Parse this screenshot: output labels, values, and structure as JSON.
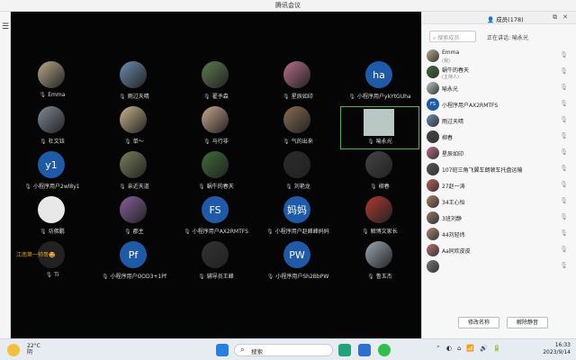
{
  "window": {
    "title": "腾讯会议"
  },
  "sidebar_left": {
    "menu_icon": "menu-icon"
  },
  "grid_tiles": [
    {
      "name": "Emma",
      "type": "photo",
      "color": "#b9a98a"
    },
    {
      "name": "雨过天晴",
      "type": "photo",
      "color": "#6a8fb0"
    },
    {
      "name": "翟予森",
      "type": "photo",
      "color": "#5d7d4f"
    },
    {
      "name": "星辰如印",
      "type": "photo",
      "color": "#b86e8a"
    },
    {
      "name": "小程序用户ykYtGUha",
      "type": "text",
      "initials": "ha",
      "color": "#1e5aa8"
    },
    {
      "name": "杜文钰",
      "type": "photo",
      "color": "#7f8b94"
    },
    {
      "name": "单～",
      "type": "photo",
      "color": "#c9b38a"
    },
    {
      "name": "马行非",
      "type": "photo",
      "color": "#c8a68e"
    },
    {
      "name": "气的出来",
      "type": "photo",
      "color": "#8a6c52"
    },
    {
      "name": "喻永光",
      "type": "video",
      "color": "#b9c8c5"
    },
    {
      "name": "小程序用户2wl8y1",
      "type": "text",
      "initials": "y1",
      "color": "#1e5aa8"
    },
    {
      "name": "亲近天道",
      "type": "photo",
      "color": "#7a7f5a"
    },
    {
      "name": "蜗牛的春天",
      "type": "photo",
      "color": "#3b6f36"
    },
    {
      "name": "刘艳龙",
      "type": "photo",
      "color": "#2b2b2b"
    },
    {
      "name": "柳春",
      "type": "photo",
      "color": "#444"
    },
    {
      "name": "坊佛鹏",
      "type": "blank",
      "color": "#e8e8e8"
    },
    {
      "name": "郡主",
      "type": "photo",
      "color": "#8a5fa0"
    },
    {
      "name": "小程序用户AX2RMTFS",
      "type": "text",
      "initials": "FS",
      "color": "#1e5aa8"
    },
    {
      "name": "小程序用户赵峰峰妈妈",
      "type": "text",
      "initials": "妈妈",
      "color": "#1e5aa8"
    },
    {
      "name": "解博文家长",
      "type": "photo",
      "color": "#b03a2e"
    },
    {
      "name": "Ti",
      "type": "photo",
      "color": "#222"
    },
    {
      "name": "小程序用户OOD3+1Pf",
      "type": "text",
      "initials": "Pf",
      "color": "#1e5aa8"
    },
    {
      "name": "辅导员王峰",
      "type": "photo",
      "color": "#333"
    },
    {
      "name": "小程序用户Sh2BbPW",
      "type": "text",
      "initials": "PW",
      "color": "#1e5aa8"
    },
    {
      "name": "鲁玉杰",
      "type": "photo",
      "color": "#9aa8b5"
    }
  ],
  "grid_extra_text": "江南第一帅哥🤩",
  "panel": {
    "title": "成员(178)",
    "search_placeholder": "搜索成员",
    "speaking_label": "正在讲话:",
    "speaking_name": "喻永光",
    "rename_button": "修改名称",
    "unmute_button": "解除静音"
  },
  "members": [
    {
      "name": "Emma",
      "sub": "(我)",
      "type": "photo",
      "color": "#b9a98a"
    },
    {
      "name": "蜗牛的春天",
      "sub": "(主持人)",
      "type": "photo",
      "color": "#3b6f36"
    },
    {
      "name": "喻永光",
      "sub": "",
      "type": "photo",
      "color": "#b9c8c5"
    },
    {
      "name": "小程序用户AX2RMTFS",
      "sub": "",
      "type": "text",
      "initials": "FS",
      "color": "#1e5aa8"
    },
    {
      "name": "雨过天晴",
      "sub": "",
      "type": "photo",
      "color": "#6a8fb0"
    },
    {
      "name": "柳春",
      "sub": "",
      "type": "photo",
      "color": "#444"
    },
    {
      "name": "星辰如印",
      "sub": "",
      "type": "photo",
      "color": "#b86e8a"
    },
    {
      "name": "107班三角飞翼车朗顿车托盘运输",
      "sub": "",
      "type": "photo",
      "color": "#555"
    },
    {
      "name": "27赵一涛",
      "sub": "",
      "type": "photo",
      "color": "#c06050"
    },
    {
      "name": "34王心怡",
      "sub": "",
      "type": "photo",
      "color": "#b08060"
    },
    {
      "name": "3班刘静",
      "sub": "",
      "type": "photo",
      "color": "#8f7a6a"
    },
    {
      "name": "44刘轻纬",
      "sub": "",
      "type": "photo",
      "color": "#aa8877"
    },
    {
      "name": "Aa同欢皮皮",
      "sub": "",
      "type": "photo",
      "color": "#c27070"
    },
    {
      "name": "",
      "sub": "",
      "type": "photo",
      "color": "#777"
    }
  ],
  "taskbar": {
    "temp": "22°C",
    "weather": "阴",
    "search_label": "搜索",
    "time": "16:33",
    "date": "2023/9/14",
    "badge": "1"
  }
}
